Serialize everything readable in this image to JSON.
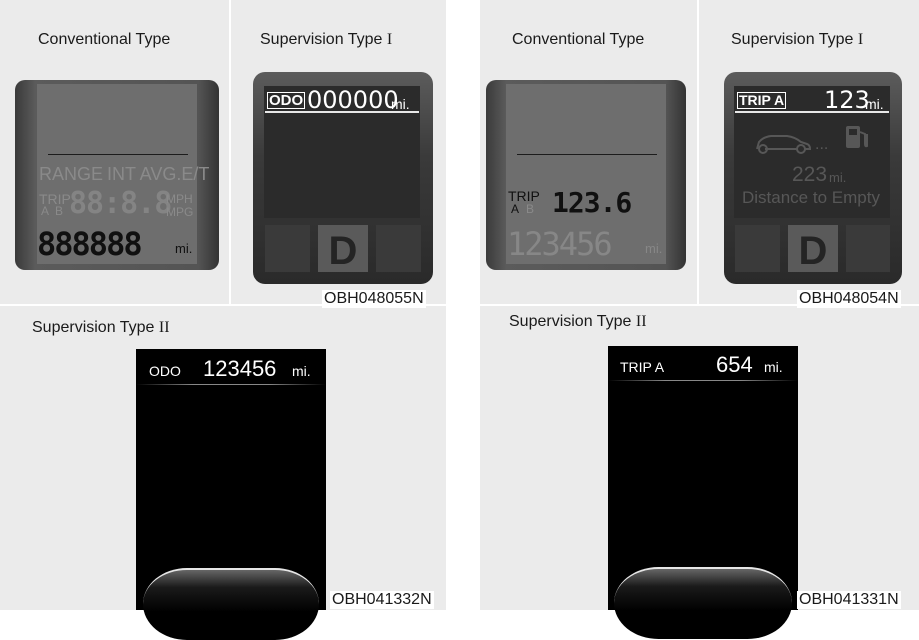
{
  "left_group": {
    "conventional": {
      "title": "Conventional Type",
      "range_label": "RANGE",
      "int_avg_label": "INT AVG.E/T",
      "trip_label": "TRIP",
      "a_label": "A",
      "b_label": "B",
      "segment_digits": "88:8.8",
      "mph_label": "MPH",
      "mpg_label": "MPG",
      "odo_digits": "888888",
      "unit": "mi."
    },
    "supervision1": {
      "title_text": "Supervision Type ",
      "title_numeral": "I",
      "mode_label": "ODO",
      "value": "000000",
      "unit": "mi.",
      "gear": "D"
    },
    "code": "OBH048055N",
    "supervision2": {
      "title_text": "Supervision Type ",
      "title_numeral": "II",
      "mode_label": "ODO",
      "value": "123456",
      "unit": "mi.",
      "code": "OBH041332N"
    }
  },
  "right_group": {
    "conventional": {
      "title": "Conventional Type",
      "trip_label": "TRIP",
      "a_label": "A",
      "b_label": "B",
      "trip_value": "123.6",
      "odo_digits": "123456",
      "unit": "mi."
    },
    "supervision1": {
      "title_text": "Supervision Type ",
      "title_numeral": "I",
      "mode_label": "TRIP A",
      "value": "123",
      "unit": "mi.",
      "dte_value": "223",
      "dte_unit": "mi.",
      "dte_label": "Distance to Empty",
      "gear": "D"
    },
    "code": "OBH048054N",
    "supervision2": {
      "title_text": "Supervision Type ",
      "title_numeral": "II",
      "mode_label": "TRIP A",
      "value": "654",
      "unit": "mi.",
      "code": "OBH041331N"
    }
  },
  "colors": {
    "panel_bg": "#ebebeb",
    "lcd_bg": "#6e6e6e",
    "screen_bg": "#000000"
  }
}
